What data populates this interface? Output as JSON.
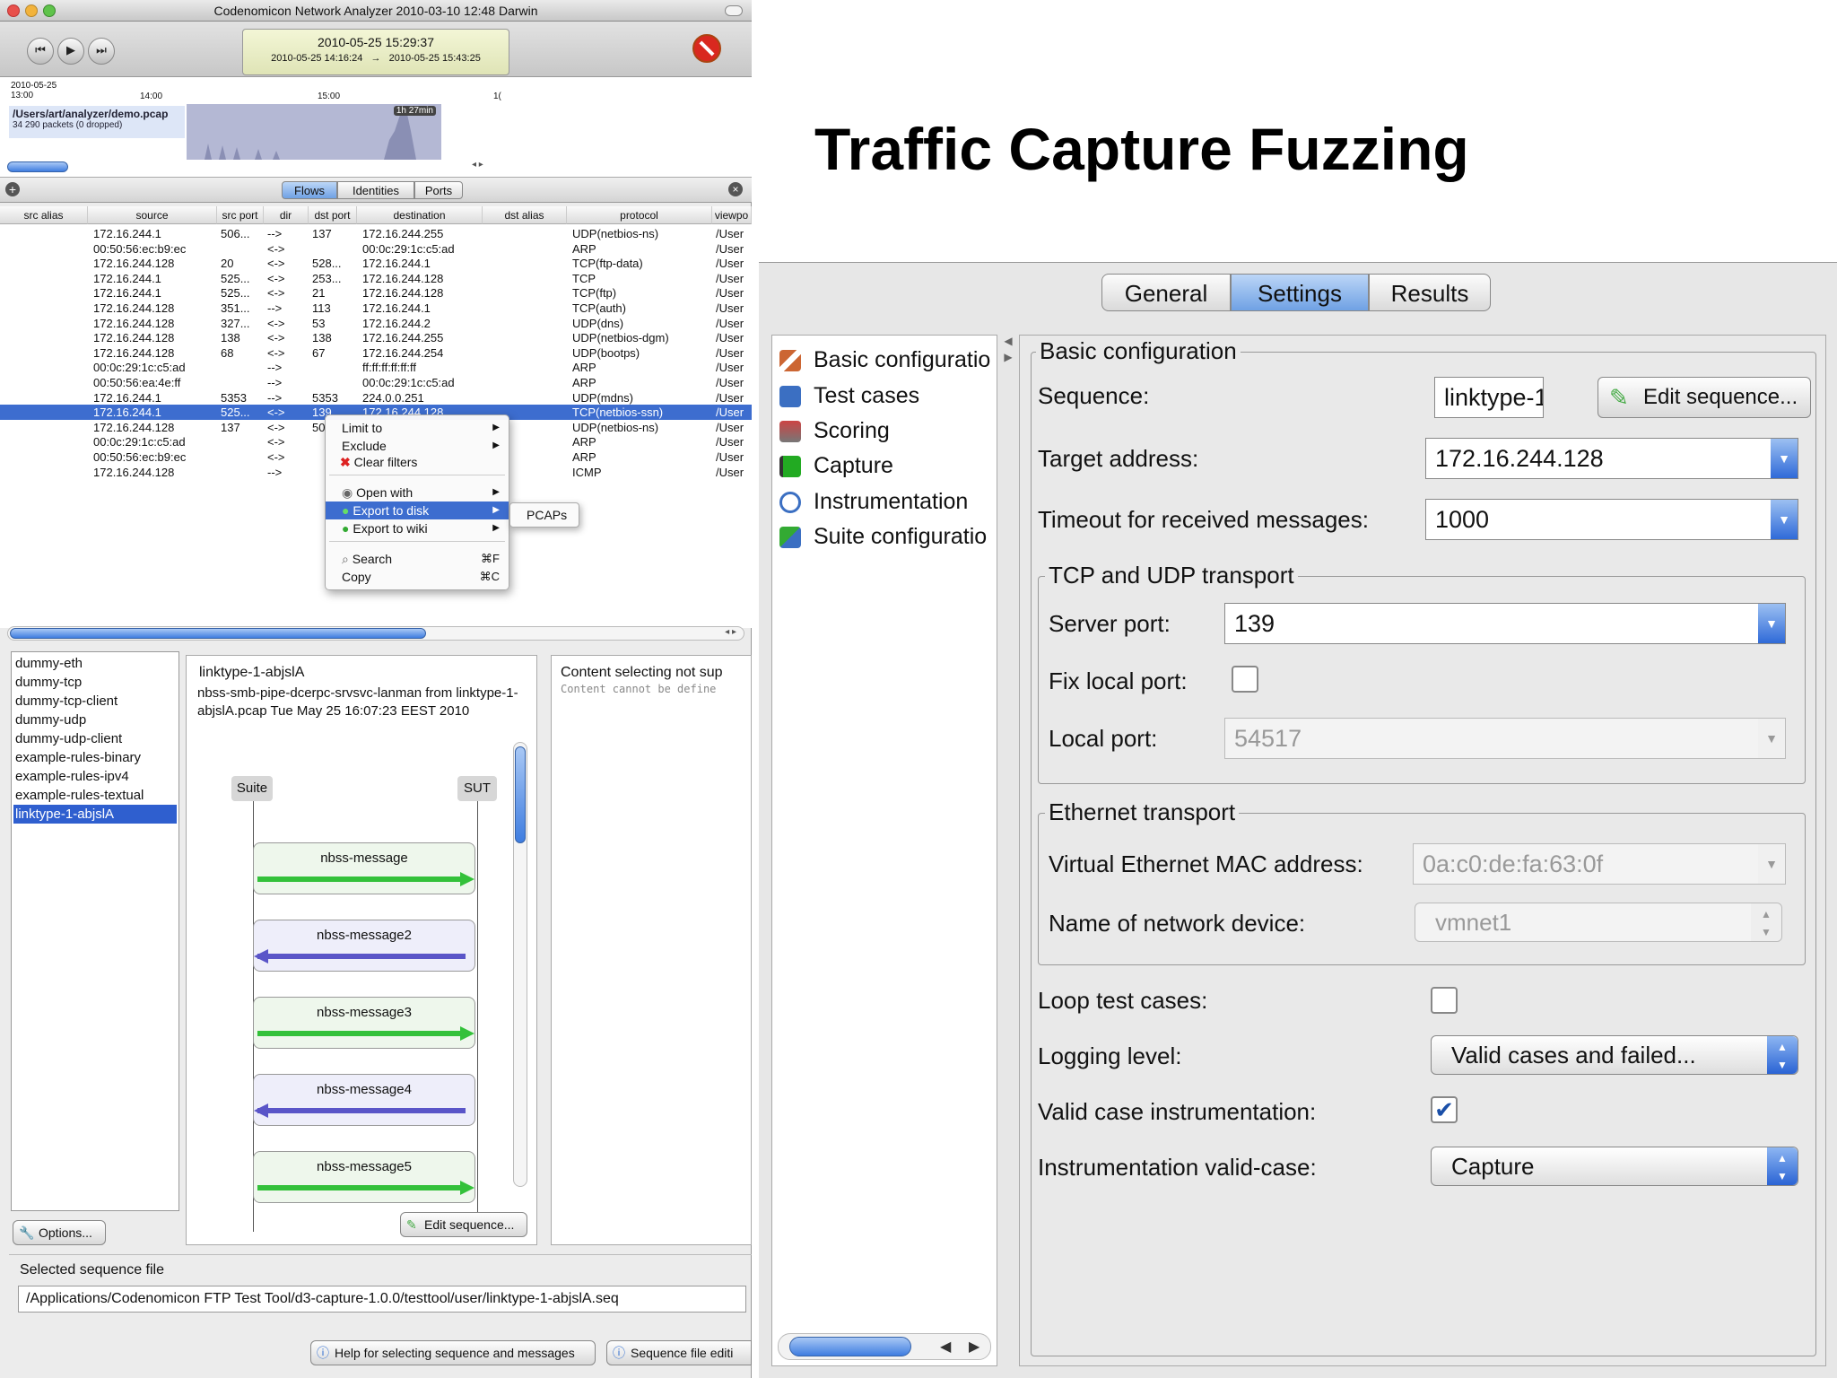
{
  "slide_title": "Traffic Capture Fuzzing",
  "analyzer": {
    "window_title": "Codenomicon Network Analyzer 2010-03-10 12:48 Darwin",
    "current_time": "2010-05-25 15:29:37",
    "range_start": "2010-05-25 14:16:24",
    "range_arrow": "→",
    "range_end": "2010-05-25 15:43:25",
    "timeline": {
      "date": "2010-05-25",
      "t1": "13:00",
      "t2": "14:00",
      "t3": "15:00",
      "t4": "1(",
      "file": "/Users/art/analyzer/demo.pcap",
      "packets": "34 290 packets (0 dropped)",
      "duration": "1h 27min"
    },
    "filter_tabs": [
      "Flows",
      "Identities",
      "Ports"
    ],
    "columns": [
      "src alias",
      "source",
      "src port",
      "dir",
      "dst port",
      "destination",
      "dst alias",
      "protocol",
      "viewpo"
    ],
    "rows": [
      [
        "",
        "172.16.244.1",
        "506...",
        "-->",
        "137",
        "172.16.244.255",
        "",
        "UDP(netbios-ns)",
        "/User"
      ],
      [
        "",
        "00:50:56:ec:b9:ec",
        "",
        "<->",
        "",
        "00:0c:29:1c:c5:ad",
        "",
        "ARP",
        "/User"
      ],
      [
        "",
        "172.16.244.128",
        "20",
        "<->",
        "528...",
        "172.16.244.1",
        "",
        "TCP(ftp-data)",
        "/User"
      ],
      [
        "",
        "172.16.244.1",
        "525...",
        "<->",
        "253...",
        "172.16.244.128",
        "",
        "TCP",
        "/User"
      ],
      [
        "",
        "172.16.244.1",
        "525...",
        "<->",
        "21",
        "172.16.244.128",
        "",
        "TCP(ftp)",
        "/User"
      ],
      [
        "",
        "172.16.244.128",
        "351...",
        "-->",
        "113",
        "172.16.244.1",
        "",
        "TCP(auth)",
        "/User"
      ],
      [
        "",
        "172.16.244.128",
        "327...",
        "<->",
        "53",
        "172.16.244.2",
        "",
        "UDP(dns)",
        "/User"
      ],
      [
        "",
        "172.16.244.128",
        "138",
        "<->",
        "138",
        "172.16.244.255",
        "",
        "UDP(netbios-dgm)",
        "/User"
      ],
      [
        "",
        "172.16.244.128",
        "68",
        "<->",
        "67",
        "172.16.244.254",
        "",
        "UDP(bootps)",
        "/User"
      ],
      [
        "",
        "00:0c:29:1c:c5:ad",
        "",
        "-->",
        "",
        "ff:ff:ff:ff:ff:ff",
        "",
        "ARP",
        "/User"
      ],
      [
        "",
        "00:50:56:ea:4e:ff",
        "",
        "-->",
        "",
        "00:0c:29:1c:c5:ad",
        "",
        "ARP",
        "/User"
      ],
      [
        "",
        "172.16.244.1",
        "5353",
        "-->",
        "5353",
        "224.0.0.251",
        "",
        "UDP(mdns)",
        "/User"
      ],
      [
        "",
        "172.16.244.1",
        "525...",
        "<->",
        "139",
        "172.16.244.128",
        "",
        "TCP(netbios-ssn)",
        "/User"
      ],
      [
        "",
        "172.16.244.128",
        "137",
        "<->",
        "50",
        "",
        "",
        "UDP(netbios-ns)",
        "/User"
      ],
      [
        "",
        "00:0c:29:1c:c5:ad",
        "",
        "<->",
        "",
        "",
        "",
        "ARP",
        "/User"
      ],
      [
        "",
        "00:50:56:ec:b9:ec",
        "",
        "<->",
        "",
        "",
        "",
        "ARP",
        "/User"
      ],
      [
        "",
        "172.16.244.128",
        "",
        "-->",
        "",
        "",
        "",
        "ICMP",
        "/User"
      ]
    ],
    "context_menu": {
      "limit_to": "Limit to",
      "exclude": "Exclude",
      "clear_filters": "Clear filters",
      "open_with": "Open with",
      "export_disk": "Export to disk",
      "export_wiki": "Export to wiki",
      "search": "Search",
      "search_key": "⌘F",
      "copy": "Copy",
      "copy_key": "⌘C",
      "submenu_item": "PCAPs"
    },
    "sequences": [
      "dummy-eth",
      "dummy-tcp",
      "dummy-tcp-client",
      "dummy-udp",
      "dummy-udp-client",
      "example-rules-binary",
      "example-rules-ipv4",
      "example-rules-textual",
      "linktype-1-abjslA"
    ],
    "seq_name": "linktype-1-abjslA",
    "seq_desc": "nbss-smb-pipe-dcerpc-srvsvc-lanman from linktype-1-abjslA.pcap Tue May 25 16:07:23 EEST 2010",
    "lane_left": "Suite",
    "lane_right": "SUT",
    "messages": [
      "nbss-message",
      "nbss-message2",
      "nbss-message3",
      "nbss-message4",
      "nbss-message5"
    ],
    "content_title": "Content selecting not sup",
    "content_sub": "Content cannot be define",
    "edit_sequence": "Edit sequence...",
    "options": "Options...",
    "selected_file_label": "Selected sequence file",
    "selected_file_path": "/Applications/Codenomicon FTP Test Tool/d3-capture-1.0.0/testtool/user/linktype-1-abjslA.seq",
    "help_btn": "Help for selecting sequence and messages",
    "seqedit_btn": "Sequence file editi"
  },
  "config": {
    "tabs": [
      "General",
      "Settings",
      "Results"
    ],
    "nav": [
      "Basic configuratio",
      "Test cases",
      "Scoring",
      "Capture",
      "Instrumentation",
      "Suite configuratio"
    ],
    "group_title": "Basic configuration",
    "sequence_label": "Sequence:",
    "sequence_value": "linktype-1-",
    "edit_sequence": "Edit sequence...",
    "target_label": "Target address:",
    "target_value": "172.16.244.128",
    "timeout_label": "Timeout for received messages:",
    "timeout_value": "1000",
    "tcpudp_title": "TCP and UDP transport",
    "server_port_label": "Server port:",
    "server_port_value": "139",
    "fix_local_label": "Fix local port:",
    "local_port_label": "Local port:",
    "local_port_value": "54517",
    "eth_title": "Ethernet transport",
    "mac_label": "Virtual Ethernet MAC address:",
    "mac_value": "0a:c0:de:fa:63:0f",
    "netdev_label": "Name of network device:",
    "netdev_value": "vmnet1",
    "loop_label": "Loop test cases:",
    "logging_label": "Logging level:",
    "logging_value": "Valid cases and failed...",
    "vci_label": "Valid case instrumentation:",
    "ivc_label": "Instrumentation valid-case:",
    "ivc_value": "Capture"
  }
}
